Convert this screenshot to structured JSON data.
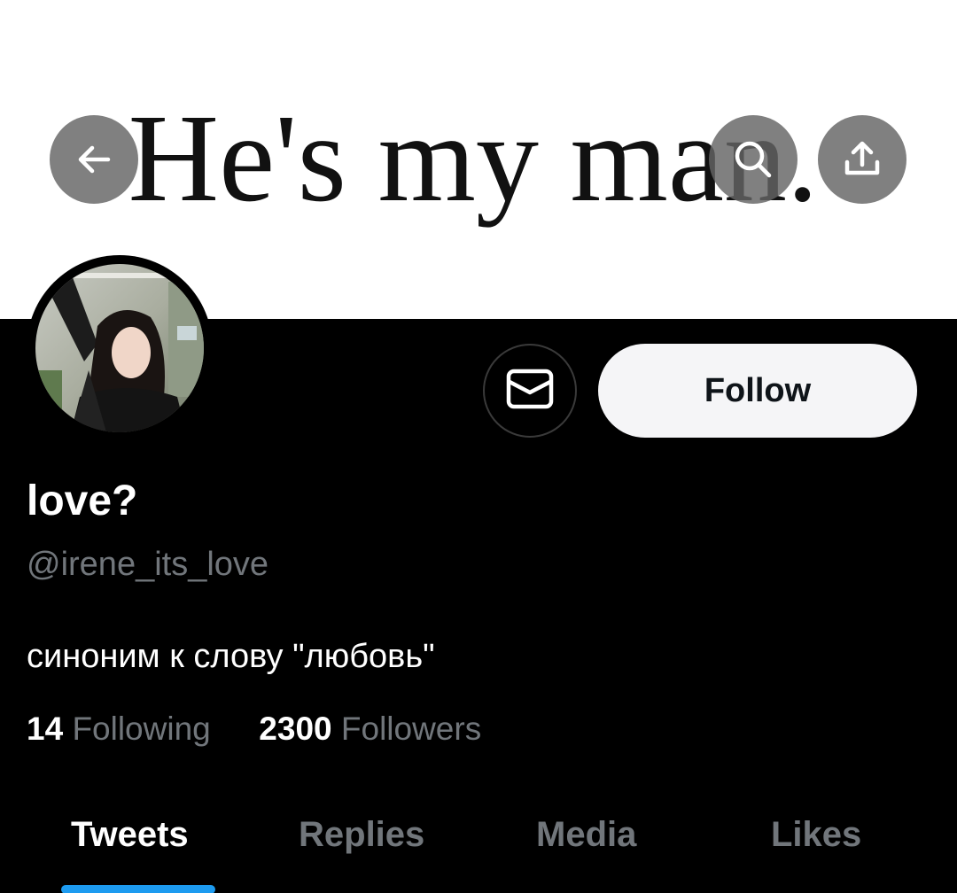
{
  "banner": {
    "text": "He's my man.",
    "background": "#ffffff"
  },
  "nav": {
    "back_icon": "arrow-left-icon",
    "search_icon": "search-icon",
    "share_icon": "share-icon"
  },
  "profile": {
    "display_name": "love?",
    "handle": "@irene_its_love",
    "bio": "синоним к слову \"любовь\"",
    "following_count": "14",
    "following_label": "Following",
    "followers_count": "2300",
    "followers_label": "Followers"
  },
  "actions": {
    "message_icon": "envelope-icon",
    "follow_label": "Follow"
  },
  "tabs": [
    {
      "label": "Tweets",
      "active": true
    },
    {
      "label": "Replies",
      "active": false
    },
    {
      "label": "Media",
      "active": false
    },
    {
      "label": "Likes",
      "active": false
    }
  ],
  "colors": {
    "background": "#000000",
    "accent": "#1d9bf0",
    "secondary_text": "#71767b",
    "follow_button_bg": "#f5f5f7"
  }
}
